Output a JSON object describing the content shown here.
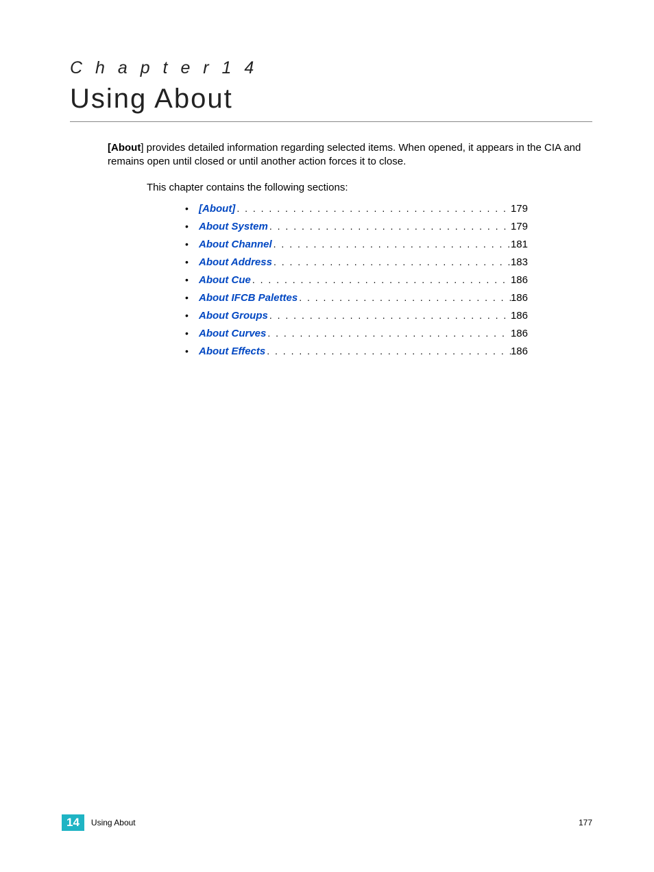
{
  "header": {
    "chapter_label": "C h a p t e r   1 4",
    "title": "Using About"
  },
  "intro": {
    "bold_lead": "[About",
    "rest": "] provides detailed information regarding selected items. When opened, it appears in the CIA and remains open until closed or until another action forces it to close."
  },
  "sections_intro": "This chapter contains the following sections:",
  "toc": [
    {
      "label": "[About]",
      "page": "179"
    },
    {
      "label": "About System",
      "page": "179"
    },
    {
      "label": "About Channel",
      "page": "181"
    },
    {
      "label": "About Address",
      "page": "183"
    },
    {
      "label": "About Cue",
      "page": "186"
    },
    {
      "label": "About IFCB Palettes",
      "page": "186"
    },
    {
      "label": "About Groups",
      "page": "186"
    },
    {
      "label": "About Curves",
      "page": "186"
    },
    {
      "label": "About Effects",
      "page": "186"
    }
  ],
  "footer": {
    "badge": "14",
    "title": "Using About",
    "page_number": "177"
  }
}
